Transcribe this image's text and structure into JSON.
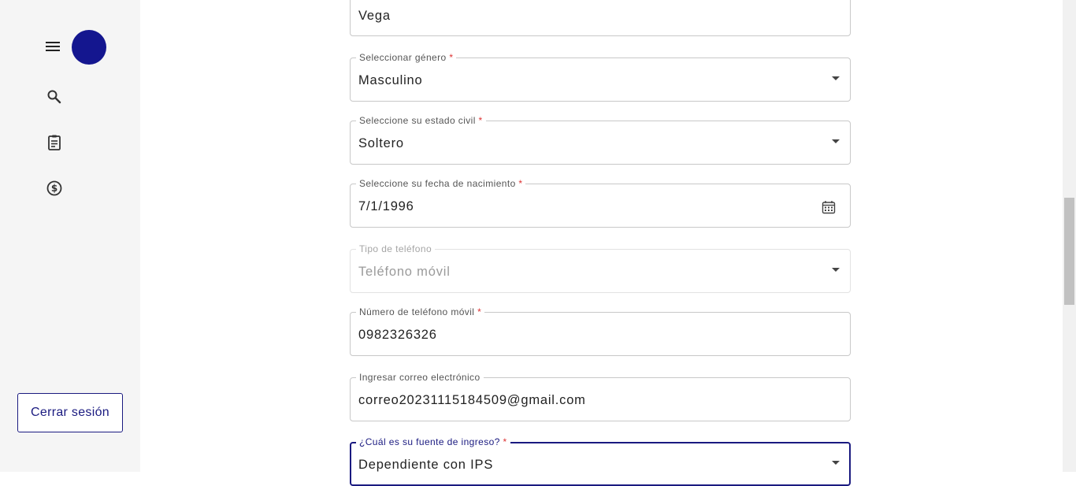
{
  "sidebar": {
    "logout_label": "Cerrar sesión",
    "avatar_color": "#14168f",
    "icons": [
      "menu-icon",
      "search-icon",
      "clipboard-icon",
      "dollar-circle-icon"
    ]
  },
  "form": {
    "last_name": {
      "value": "Vega"
    },
    "gender": {
      "label": "Seleccionar género",
      "required": "*",
      "value": "Masculino"
    },
    "civil_status": {
      "label": "Seleccione su estado civil",
      "required": "*",
      "value": "Soltero"
    },
    "birth_date": {
      "label": "Seleccione su fecha de nacimiento",
      "required": "*",
      "value": "7/1/1996"
    },
    "phone_type": {
      "label": "Tipo de teléfono",
      "value": "Teléfono móvil"
    },
    "mobile_number": {
      "label": "Número de teléfono móvil",
      "required": "*",
      "value": "0982326326"
    },
    "email": {
      "label": "Ingresar correo electrónico",
      "value": "correo20231115184509@gmail.com"
    },
    "income_source": {
      "label": "¿Cuál es su fuente de ingreso?",
      "required": "*",
      "value": "Dependiente con IPS"
    }
  },
  "colors": {
    "accent": "#1a1a80",
    "required": "#dd3333",
    "sidebar_bg": "#f5f5f5"
  }
}
